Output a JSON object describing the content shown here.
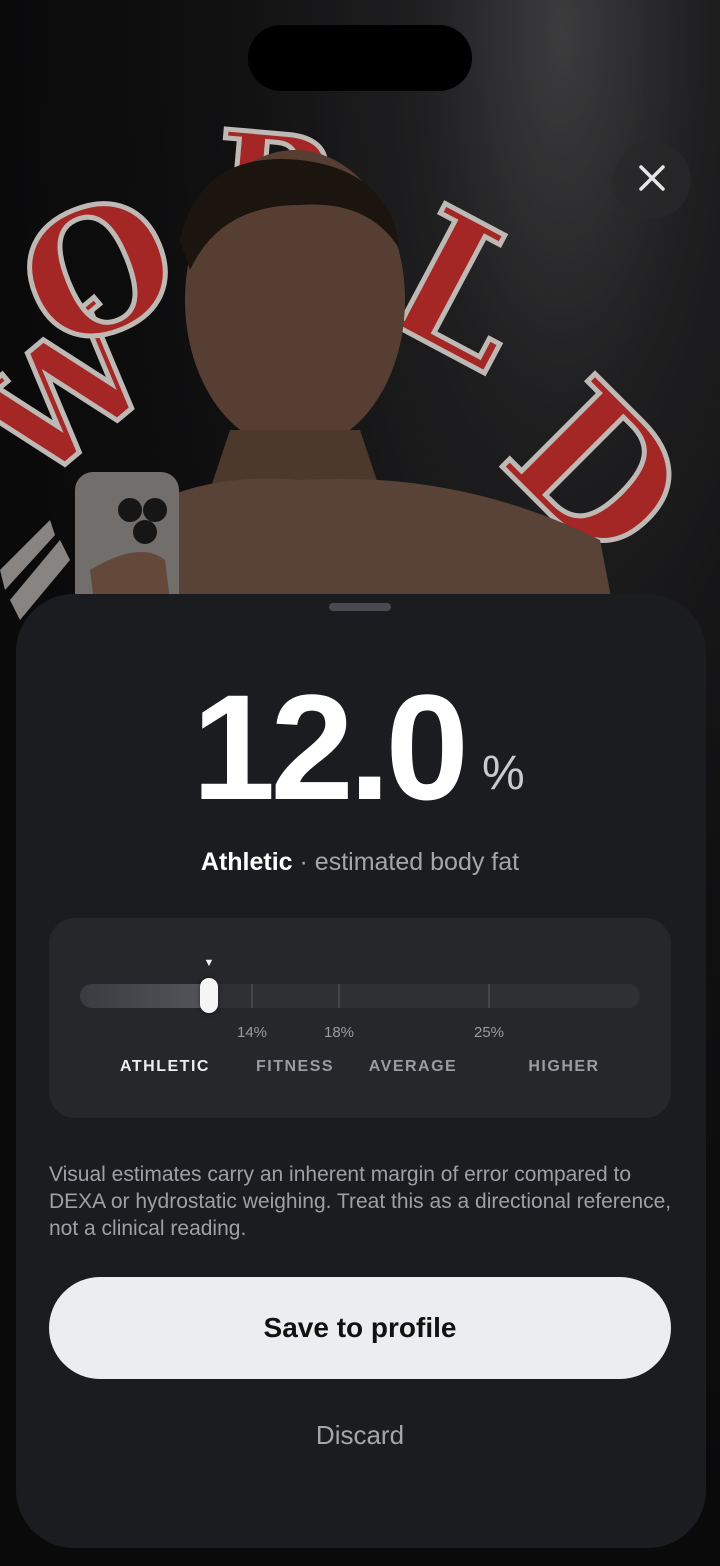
{
  "background": {
    "description_icon": "camera-photo-background"
  },
  "close_button": {
    "icon": "close-icon"
  },
  "result": {
    "value": "12.0",
    "unit": "%",
    "category": "Athletic",
    "descriptor": "· estimated body fat"
  },
  "range": {
    "current_fraction": 0.23,
    "tick_labels": [
      "14%",
      "18%",
      "25%"
    ],
    "zones": [
      "ATHLETIC",
      "FITNESS",
      "AVERAGE",
      "HIGHER"
    ],
    "active_zone": "ATHLETIC"
  },
  "disclaimer": "Visual estimates carry an inherent margin of error compared to DEXA or hydrostatic weighing. Treat this as a directional reference, not a clinical reading.",
  "actions": {
    "save_label": "Save to profile",
    "discard_label": "Discard"
  },
  "colors": {
    "sheet": "#1b1c1f",
    "card": "#26272b",
    "primary_button": "#ecedf0",
    "accent_red": "#c8302e"
  }
}
